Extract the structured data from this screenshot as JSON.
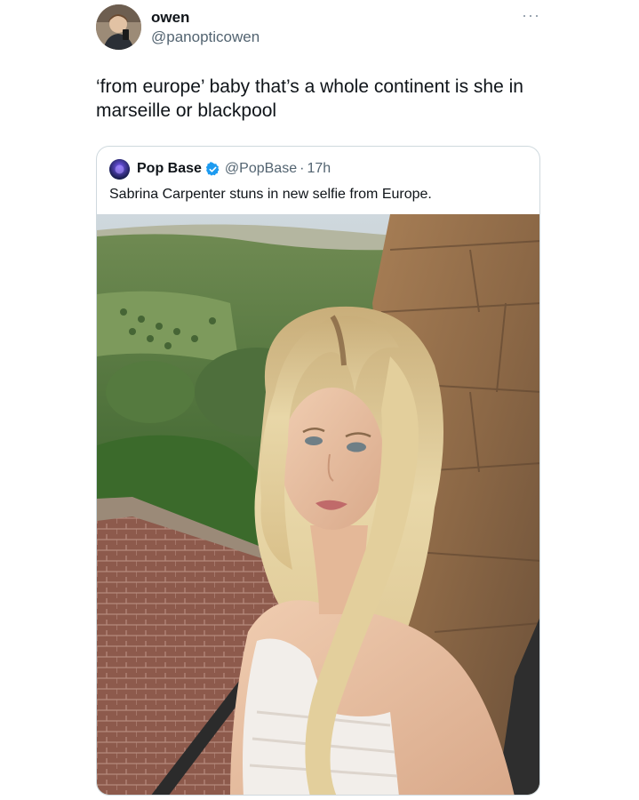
{
  "tweet": {
    "author_name": "owen",
    "author_handle": "@panopticowen",
    "more_icon": "ellipsis-icon",
    "text": "‘from europe’ baby that’s a whole continent is she in marseille or blackpool"
  },
  "quoted_tweet": {
    "author_name": "Pop Base",
    "verified_icon": "verified-badge-icon",
    "author_handle": "@PopBase",
    "separator": "·",
    "time": "17h",
    "text": "Sabrina Carpenter stuns in new selfie from Europe.",
    "verified_color": "#1d9bf0"
  }
}
